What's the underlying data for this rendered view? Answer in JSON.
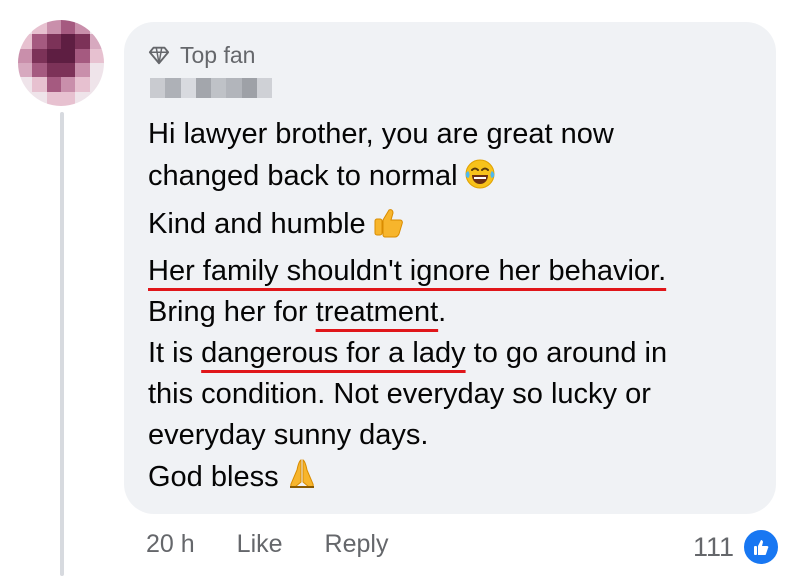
{
  "comment": {
    "badge_label": "Top fan",
    "lines": [
      "Hi lawyer brother, you are great now",
      "changed back to normal",
      "Kind and humble",
      "Her family shouldn't ignore her behavior.",
      "Bring her for ",
      "treatment",
      ".",
      "It is ",
      "dangerous for a lady",
      " to go around in",
      "this condition. Not everyday so lucky or",
      "everyday sunny days.",
      "God bless"
    ],
    "emojis": {
      "after_line_2": "face-with-tears-of-joy-emoji",
      "after_line_3": "thumbs-up-emoji",
      "after_line_13": "folded-hands-emoji"
    },
    "underline_color": "#e0161a"
  },
  "actions": {
    "time": "20 h",
    "like": "Like",
    "reply": "Reply"
  },
  "reactions": {
    "count": "111",
    "icon": "like-reaction-icon"
  },
  "colors": {
    "bubble": "#f0f2f5",
    "meta_text": "#65676b",
    "like_blue": "#1877f2"
  }
}
